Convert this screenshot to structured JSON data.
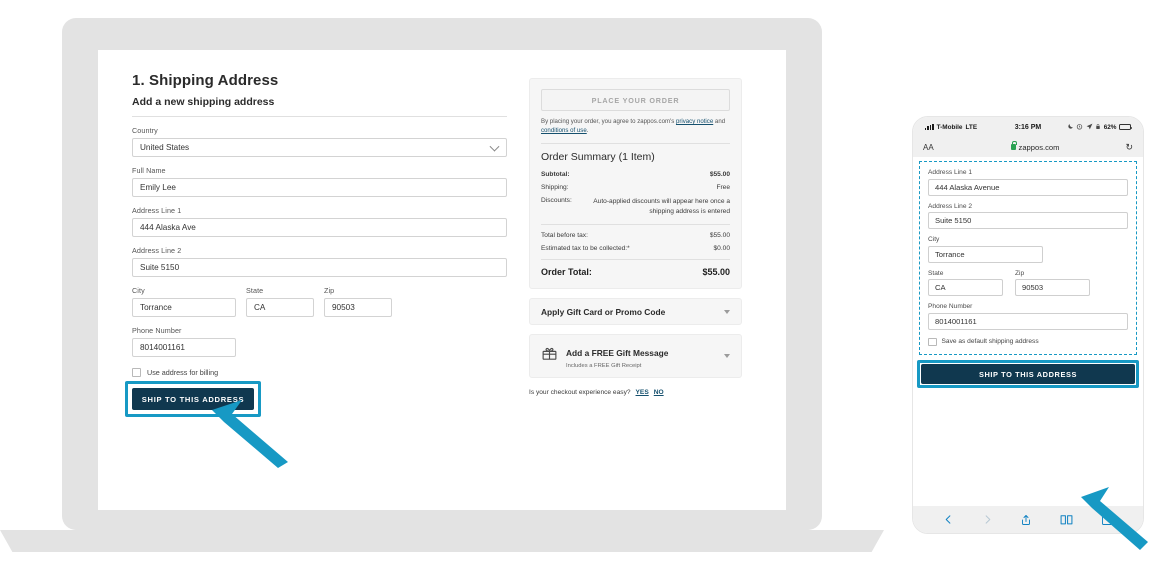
{
  "accent": {
    "highlight": "#1799c4",
    "button": "#10384f",
    "link": "#15506e",
    "lock_green": "#2aa152",
    "battery": "#f2c200"
  },
  "desktop": {
    "heading": "1. Shipping Address",
    "subheading": "Add a new shipping address",
    "fields": {
      "country_label": "Country",
      "country_value": "United States",
      "fullname_label": "Full Name",
      "fullname_value": "Emily Lee",
      "address1_label": "Address Line 1",
      "address1_value": "444 Alaska Ave",
      "address2_label": "Address Line 2",
      "address2_value": "Suite 5150",
      "city_label": "City",
      "city_value": "Torrance",
      "state_label": "State",
      "state_value": "CA",
      "zip_label": "Zip",
      "zip_value": "90503",
      "phone_label": "Phone Number",
      "phone_value": "8014001161"
    },
    "billing_checkbox_label": "Use address for billing",
    "ship_button": "SHIP TO THIS ADDRESS"
  },
  "summary": {
    "place_order_button": "PLACE YOUR ORDER",
    "legal_prefix": "By placing your order, you agree to zappos.com's ",
    "legal_link1": "privacy notice",
    "legal_mid": " and ",
    "legal_link2": "conditions of use",
    "legal_suffix": ".",
    "title": "Order Summary (1 Item)",
    "rows": [
      {
        "label": "Subtotal:",
        "value": "$55.00",
        "bold": true
      },
      {
        "label": "Shipping:",
        "value": "Free",
        "bold": false
      }
    ],
    "discount_label": "Discounts:",
    "discount_value": "Auto-applied discounts will appear here once a shipping address is entered",
    "rows2": [
      {
        "label": "Total before tax:",
        "value": "$55.00"
      },
      {
        "label": "Estimated tax to be collected:*",
        "value": "$0.00"
      }
    ],
    "total_label": "Order Total:",
    "total_value": "$55.00",
    "promo_label": "Apply Gift Card or Promo Code",
    "gift_title": "Add a FREE Gift Message",
    "gift_sub": "Includes a FREE Gift Receipt",
    "feedback_question": "Is your checkout experience easy?",
    "feedback_yes": "YES",
    "feedback_no": "NO"
  },
  "phone": {
    "status": {
      "carrier": "T-Mobile",
      "network": "LTE",
      "time": "3:16 PM",
      "battery": "62%"
    },
    "browser": {
      "text_size_button": "AA",
      "url": "zappos.com",
      "reload_glyph": "↻"
    },
    "fields": {
      "address1_label": "Address Line 1",
      "address1_value": "444 Alaska Avenue",
      "address2_label": "Address Line 2",
      "address2_value": "Suite 5150",
      "city_label": "City",
      "city_value": "Torrance",
      "state_label": "State",
      "state_value": "CA",
      "zip_label": "Zip",
      "zip_value": "90503",
      "phone_label": "Phone Number",
      "phone_value": "8014001161"
    },
    "default_checkbox_label": "Save as default shipping address",
    "ship_button": "SHIP TO THIS ADDRESS"
  }
}
